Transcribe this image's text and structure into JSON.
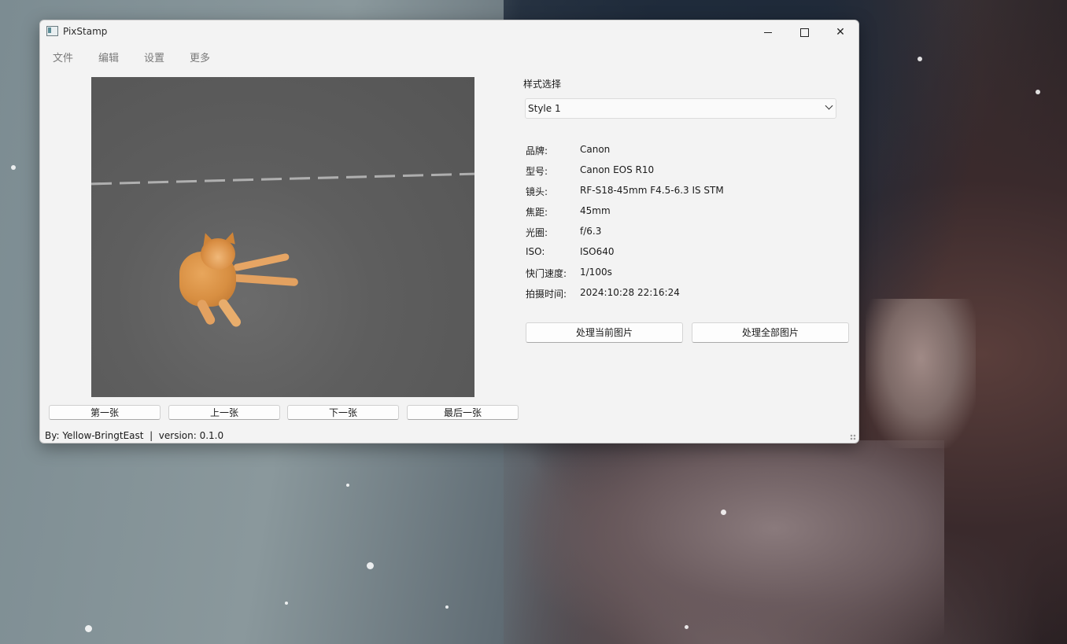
{
  "window": {
    "title": "PixStamp",
    "controls": {
      "minimize": "—",
      "maximize": "☐",
      "close": "✕"
    }
  },
  "menu": [
    "文件",
    "编辑",
    "设置",
    "更多"
  ],
  "preview": {
    "image_icon": "cat-photo"
  },
  "navigation": {
    "first": "第一张",
    "prev": "上一张",
    "next": "下一张",
    "last": "最后一张"
  },
  "status": "By: Yellow-BringtEast  |  version: 0.1.0",
  "style_select": {
    "label": "样式选择",
    "value": "Style 1"
  },
  "exif": [
    {
      "label": "品牌:",
      "value": "Canon"
    },
    {
      "label": "型号:",
      "value": "Canon EOS R10"
    },
    {
      "label": "镜头:",
      "value": "RF-S18-45mm F4.5-6.3 IS STM"
    },
    {
      "label": "焦距:",
      "value": "45mm"
    },
    {
      "label": "光圈:",
      "value": "f/6.3"
    },
    {
      "label": "ISO:",
      "value": "ISO640"
    },
    {
      "label": "快门速度:",
      "value": "1/100s"
    },
    {
      "label": "拍摄时间:",
      "value": "2024:10:28 22:16:24"
    }
  ],
  "actions": {
    "process_current": "处理当前图片",
    "process_all": "处理全部图片"
  }
}
